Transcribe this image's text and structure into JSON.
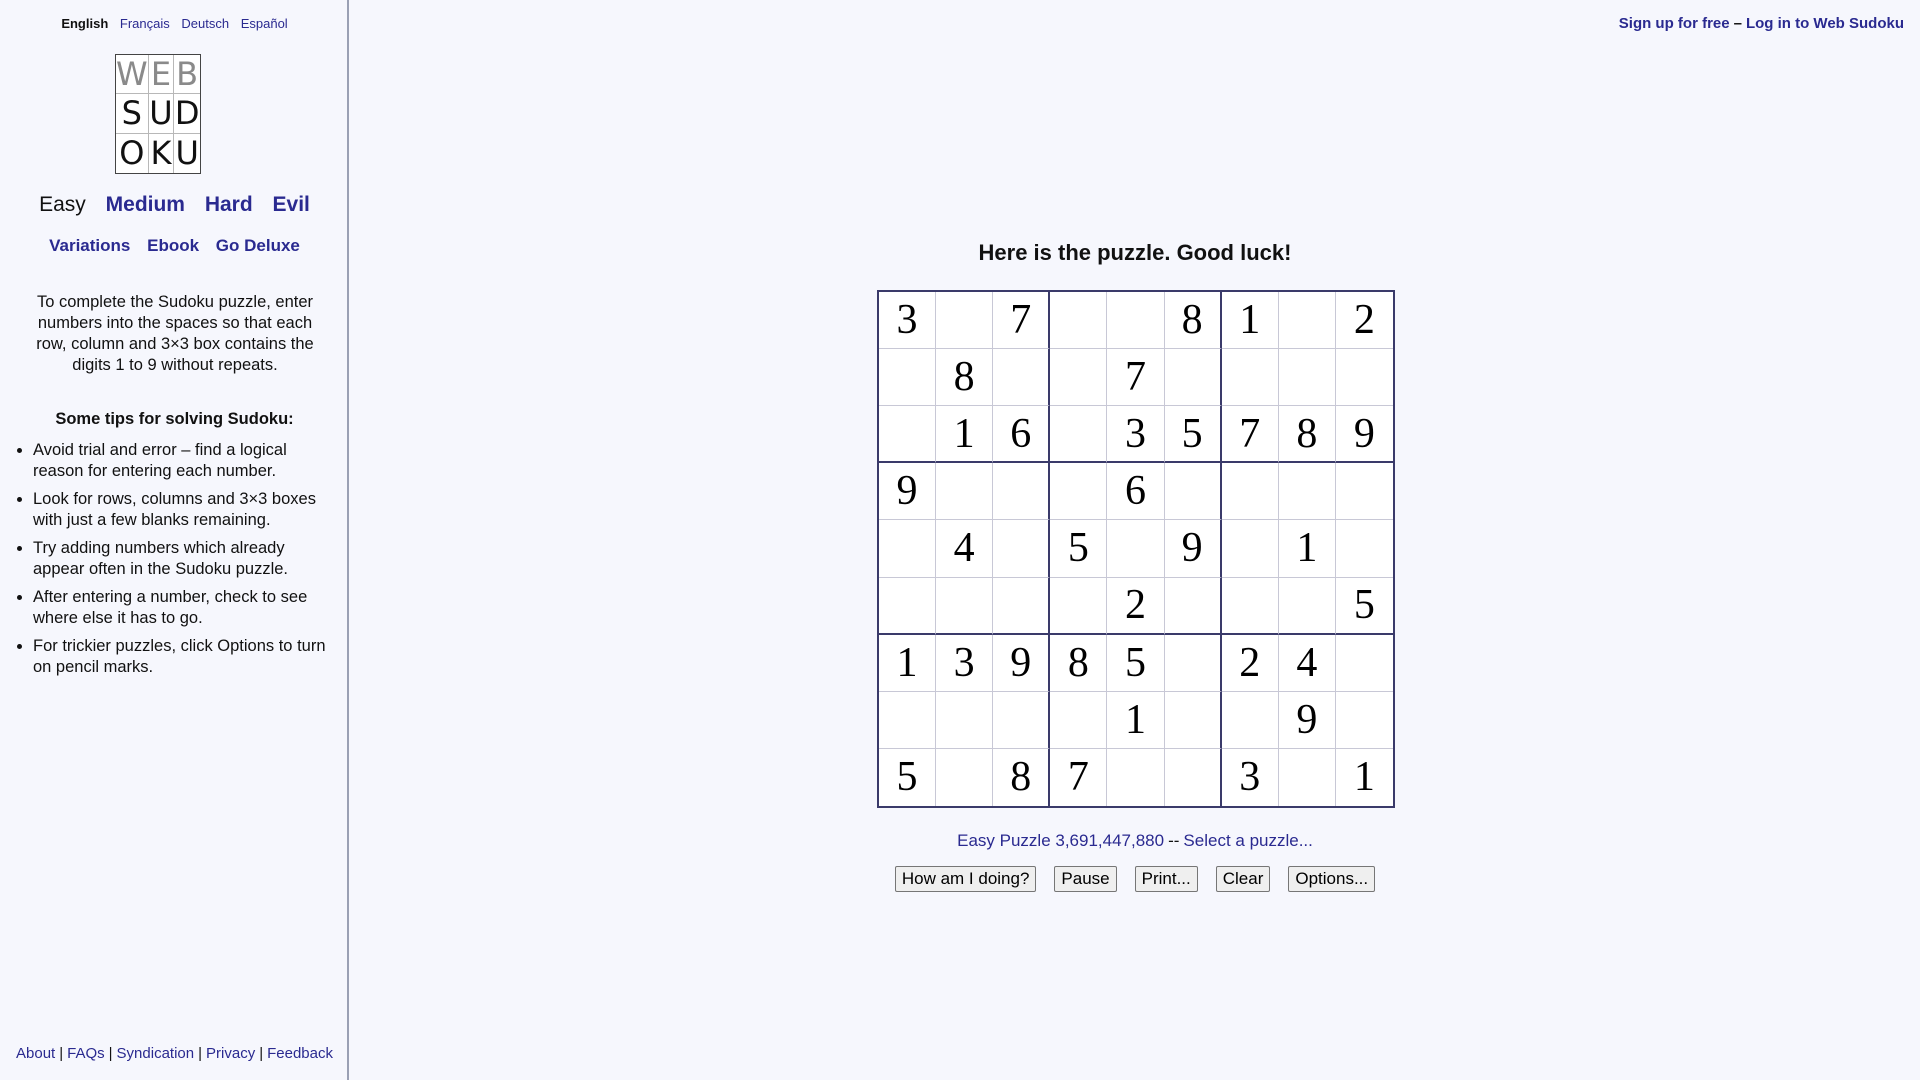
{
  "sidebar": {
    "languages": [
      "English",
      "Français",
      "Deutsch",
      "Español"
    ],
    "logo_letters": [
      "W",
      "E",
      "B",
      "S",
      "U",
      "D",
      "O",
      "K",
      "U"
    ],
    "levels": [
      "Easy",
      "Medium",
      "Hard",
      "Evil"
    ],
    "extras": [
      "Variations",
      "Ebook",
      "Go Deluxe"
    ],
    "intro": "To complete the Sudoku puzzle, enter numbers into the spaces so that each row, column and 3×3 box contains the digits 1 to 9 without repeats.",
    "tips_title": "Some tips for solving Sudoku:",
    "tips": [
      "Avoid trial and error – find a logical reason for entering each number.",
      "Look for rows, columns and 3×3 boxes with just a few blanks remaining.",
      "Try adding numbers which already appear often in the Sudoku puzzle.",
      "After entering a number, check to see where else it has to go.",
      "For trickier puzzles, click Options to turn on pencil marks."
    ],
    "footer_links": [
      "About",
      "FAQs",
      "Syndication",
      "Privacy",
      "Feedback"
    ],
    "footer_sep": "|"
  },
  "header": {
    "signup": "Sign up for free",
    "dash": "–",
    "login": "Log in to Web Sudoku"
  },
  "main": {
    "heading": "Here is the puzzle. Good luck!",
    "grid": [
      [
        "3",
        "",
        "7",
        "",
        "",
        "8",
        "1",
        "",
        "2"
      ],
      [
        "",
        "8",
        "",
        "",
        "7",
        "",
        "",
        "",
        ""
      ],
      [
        "",
        "1",
        "6",
        "",
        "3",
        "5",
        "7",
        "8",
        "9"
      ],
      [
        "9",
        "",
        "",
        "",
        "6",
        "",
        "",
        "",
        ""
      ],
      [
        "",
        "4",
        "",
        "5",
        "",
        "9",
        "",
        "1",
        ""
      ],
      [
        "",
        "",
        "",
        "",
        "2",
        "",
        "",
        "",
        "5"
      ],
      [
        "1",
        "3",
        "9",
        "8",
        "5",
        "",
        "2",
        "4",
        ""
      ],
      [
        "",
        "",
        "",
        "",
        "1",
        "",
        "",
        "9",
        ""
      ],
      [
        "5",
        "",
        "8",
        "7",
        "",
        "",
        "3",
        "",
        "1"
      ]
    ],
    "puzzle_label": "Easy Puzzle 3,691,447,880",
    "puzzle_sep": "--",
    "select_puzzle": "Select a puzzle...",
    "buttons": [
      "How am I doing?",
      "Pause",
      "Print...",
      "Clear",
      "Options..."
    ]
  }
}
